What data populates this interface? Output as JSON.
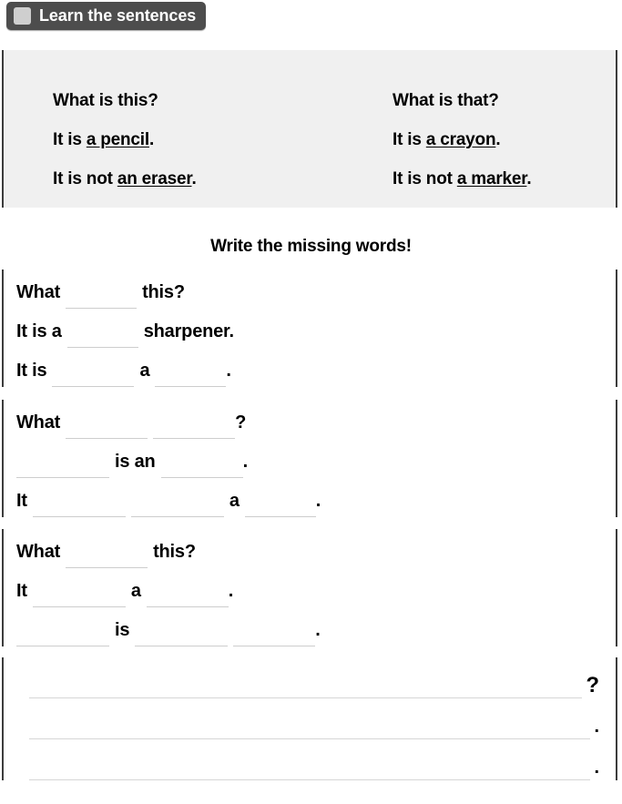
{
  "header": {
    "title": "Learn the sentences",
    "icon": "square-icon"
  },
  "example_box": {
    "left_column": [
      {
        "prefix": "What is this?",
        "underlined": "",
        "suffix": ""
      },
      {
        "prefix": "It is ",
        "underlined": "a pencil",
        "suffix": "."
      },
      {
        "prefix": "It is not ",
        "underlined": "an eraser",
        "suffix": "."
      }
    ],
    "right_column": [
      {
        "prefix": "What is that?",
        "underlined": "",
        "suffix": ""
      },
      {
        "prefix": "It is ",
        "underlined": "a crayon",
        "suffix": "."
      },
      {
        "prefix": "It is not ",
        "underlined": "a marker",
        "suffix": "."
      }
    ]
  },
  "instruction": "Write the missing words!",
  "exercises": {
    "group1": {
      "line1": {
        "t1": "What",
        "t2": "this?"
      },
      "line2": {
        "t1": "It is a",
        "t2": "sharpener."
      },
      "line3": {
        "t1": "It is",
        "t2": "a",
        "t3": "."
      }
    },
    "group2": {
      "line1": {
        "t1": "What",
        "t2": "?"
      },
      "line2": {
        "t1": "is an",
        "t2": "."
      },
      "line3": {
        "t1": "It",
        "t2": "a",
        "t3": "."
      }
    },
    "group3": {
      "line1": {
        "t1": "What",
        "t2": "this?"
      },
      "line2": {
        "t1": "It",
        "t2": "a",
        "t3": "."
      },
      "line3": {
        "t1": "is",
        "t2": "."
      }
    },
    "group4": {
      "line1_punct": "?",
      "line2_punct": ".",
      "line3_punct": "."
    }
  },
  "colors": {
    "header_bg": "#4d4d4d",
    "header_text": "#ffffff",
    "header_icon": "#cfcfcf",
    "example_bg": "#f0f0f0",
    "border": "#3c3c3c",
    "blank_line": "#cdcdcd",
    "text": "#000000"
  }
}
